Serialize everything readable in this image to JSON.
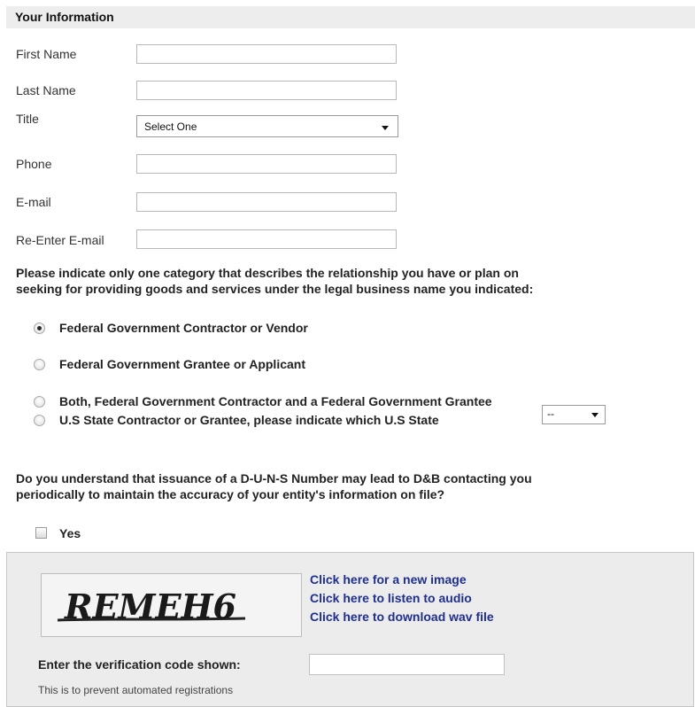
{
  "section": {
    "title": "Your Information"
  },
  "fields": {
    "first_name": {
      "label": "First Name",
      "value": ""
    },
    "last_name": {
      "label": "Last Name",
      "value": ""
    },
    "title": {
      "label": "Title",
      "selected": "Select One"
    },
    "phone": {
      "label": "Phone",
      "value": ""
    },
    "email": {
      "label": "E-mail",
      "value": ""
    },
    "reenter_email": {
      "label": "Re-Enter E-mail",
      "value": ""
    }
  },
  "category": {
    "question_line1": "Please indicate only one category that describes the relationship you have or plan on",
    "question_line2": "seeking for providing goods and services under the legal business name you indicated:",
    "options": [
      {
        "label": "Federal Government Contractor or Vendor",
        "checked": true
      },
      {
        "label": "Federal Government Grantee or Applicant",
        "checked": false
      },
      {
        "label": "Both, Federal Government Contractor and a Federal Government Grantee",
        "checked": false
      },
      {
        "label": "U.S State Contractor or Grantee, please indicate which U.S State",
        "checked": false
      }
    ],
    "state_selected": "--"
  },
  "duns": {
    "question_line1": "Do you understand that issuance of a D-U-N-S Number may lead to D&B contacting you",
    "question_line2": "periodically to maintain the accuracy of your entity's information on file?",
    "yes_label": "Yes",
    "checked": false
  },
  "captcha": {
    "image_text": "REMEH6",
    "links": [
      "Click here for a new image",
      "Click here to listen to audio",
      "Click here to download wav file"
    ],
    "verify_label": "Enter the verification code shown:",
    "verify_value": "",
    "note": "This is to prevent automated registrations"
  },
  "colors": {
    "link": "#1f2f8e",
    "header_bg": "#ededed",
    "panel_bg": "#ececec"
  }
}
